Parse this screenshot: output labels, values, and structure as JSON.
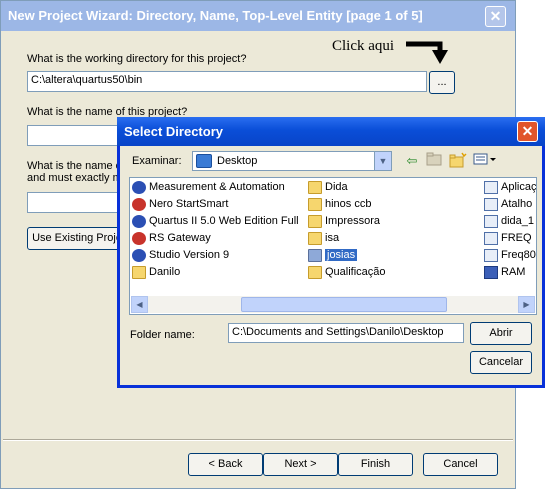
{
  "wizard": {
    "title": "New Project Wizard: Directory, Name, Top-Level Entity [page 1 of 5]",
    "close_glyph": "✕",
    "q_directory": "What is the working directory for this project?",
    "directory_value": "C:\\altera\\quartus50\\bin",
    "browse_label": "...",
    "q_name": "What is the name of this project?",
    "q_toplevel_line1": "What is the name o",
    "q_toplevel_line2": "and must exactly m",
    "use_existing_label": "Use Existing Proje",
    "buttons": {
      "back": "< Back",
      "next": "Next >",
      "finish": "Finish",
      "cancel": "Cancel"
    }
  },
  "annotation": {
    "text": "Click aqui"
  },
  "select_directory": {
    "title": "Select Directory",
    "close_glyph": "✕",
    "look_in_label": "Examinar:",
    "look_in_value": "Desktop",
    "toolbar": {
      "back_icon": "⇦",
      "up_icon": "folder-up",
      "new_folder_icon": "new-folder",
      "view_icon": "view-menu"
    },
    "items_col1": [
      {
        "label": "Measurement & Automation",
        "icon": "app-blue"
      },
      {
        "label": "Nero StartSmart",
        "icon": "app-red"
      },
      {
        "label": "Quartus II 5.0 Web Edition Full",
        "icon": "app-blue"
      },
      {
        "label": "RS Gateway",
        "icon": "app-red"
      },
      {
        "label": "Studio Version 9",
        "icon": "app-blue"
      },
      {
        "label": "Danilo",
        "icon": "folder"
      }
    ],
    "items_col2": [
      {
        "label": "Dida",
        "icon": "folder"
      },
      {
        "label": "hinos ccb",
        "icon": "folder"
      },
      {
        "label": "Impressora",
        "icon": "folder"
      },
      {
        "label": "isa",
        "icon": "folder"
      },
      {
        "label": "josias",
        "icon": "folder-sel",
        "selected": true
      },
      {
        "label": "Qualificação",
        "icon": "folder"
      }
    ],
    "items_col3": [
      {
        "label": "Aplicaç",
        "icon": "app-doc"
      },
      {
        "label": "Atalho",
        "icon": "app-doc"
      },
      {
        "label": "dida_1",
        "icon": "app-doc"
      },
      {
        "label": "FREQ",
        "icon": "app-doc"
      },
      {
        "label": "Freq80",
        "icon": "app-doc"
      },
      {
        "label": "RAM",
        "icon": "app-sq"
      }
    ],
    "folder_name_label": "Folder name:",
    "folder_name_value": "C:\\Documents and Settings\\Danilo\\Desktop",
    "open_label": "Abrir",
    "cancel_label": "Cancelar"
  },
  "colors": {
    "dialog_title": "#0a4ed8",
    "inactive_title": "#9cb7e6",
    "selection": "#316ac5",
    "close_red": "#e1552a"
  }
}
